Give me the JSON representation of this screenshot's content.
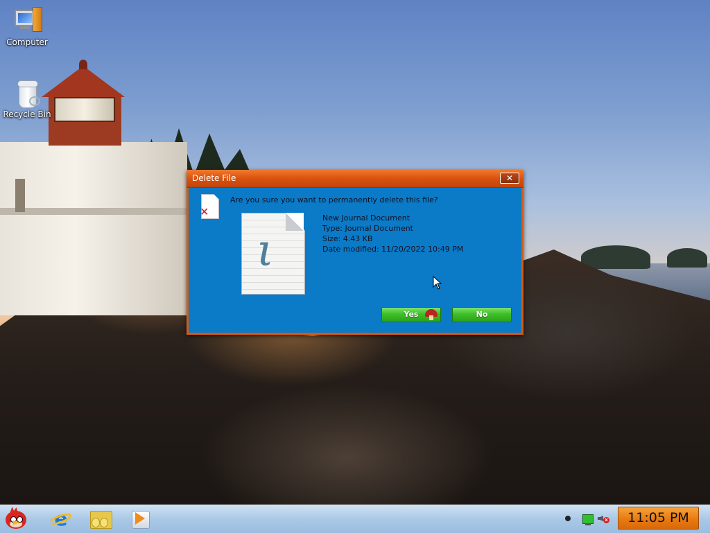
{
  "desktop": {
    "icons": [
      {
        "label": "Computer",
        "icon": "computer-icon"
      },
      {
        "label": "Recycle Bin",
        "icon": "recycle-bin-icon"
      }
    ]
  },
  "dialog": {
    "title": "Delete File",
    "close_label": "✕",
    "question": "Are you sure you want to permanently delete this file?",
    "file": {
      "name": "New Journal Document",
      "type": "Type: Journal Document",
      "size": "Size: 4.43 KB",
      "date_modified": "Date modified: 11/20/2022 10:49 PM"
    },
    "buttons": {
      "yes": "Yes",
      "no": "No"
    },
    "icons": {
      "small": "delete-document-icon",
      "large": "journal-document-icon",
      "yes_button": "mushroom-icon"
    }
  },
  "taskbar": {
    "apps": [
      {
        "name": "angry-bird-start-icon"
      },
      {
        "name": "internet-explorer-icon"
      },
      {
        "name": "folder-icon"
      },
      {
        "name": "media-player-icon"
      }
    ],
    "tray": [
      "notification-dot-icon",
      "network-icon",
      "volume-muted-icon"
    ],
    "clock": "11:05 PM"
  },
  "colors": {
    "dialog_bg": "#0b7ac7",
    "titlebar": "#d9520e",
    "button_green": "#3fbe2a",
    "clock_orange": "#e77b12",
    "taskbar": "#a9c8e6"
  }
}
